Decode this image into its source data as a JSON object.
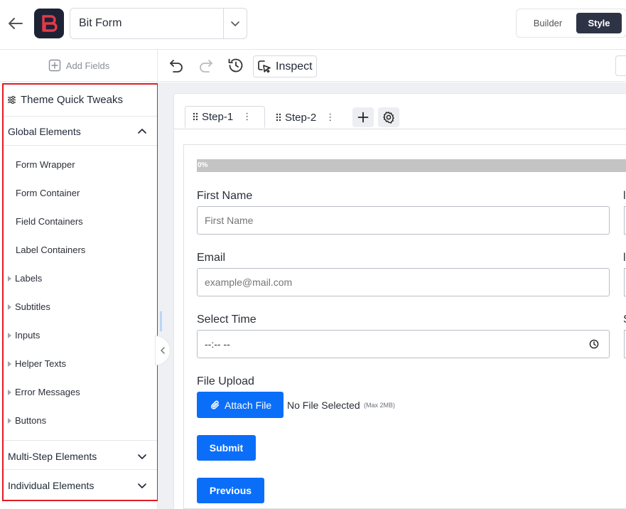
{
  "app": {
    "form_name": "Bit Form"
  },
  "header": {
    "builder_label": "Builder",
    "style_label": "Style"
  },
  "sidebar": {
    "add_fields_label": "Add Fields",
    "theme_title": "Theme Quick Tweaks",
    "global_section": "Global Elements",
    "global_items": [
      "Form Wrapper",
      "Form Container",
      "Field Containers",
      "Label Containers"
    ],
    "expandable_items": [
      "Labels",
      "Subtitles",
      "Inputs",
      "Helper Texts",
      "Error Messages",
      "Buttons"
    ],
    "multistep_section": "Multi-Step Elements",
    "individual_section": "Individual Elements"
  },
  "toolbar": {
    "inspect_label": "Inspect"
  },
  "tabs": {
    "step1": "Step-1",
    "step2": "Step-2"
  },
  "form": {
    "progress": {
      "value": 0,
      "label": "0%"
    },
    "first_name": {
      "label": "First Name",
      "placeholder": "First Name"
    },
    "email": {
      "label": "Email",
      "placeholder": "example@mail.com"
    },
    "select_time": {
      "label": "Select Time",
      "value": "--:-- --"
    },
    "file_upload": {
      "label": "File Upload",
      "button": "Attach File",
      "status": "No File Selected",
      "max_size": "(Max 2MB)"
    },
    "submit_label": "Submit",
    "previous_label": "Previous"
  },
  "colors": {
    "primary_button": "#0a6ef9",
    "highlight_border": "#e01b24",
    "style_tab_bg": "#2e3446",
    "logo_bg": "#1e2235",
    "logo_accent": "#e23a48"
  },
  "icons": [
    "back-arrow-icon",
    "bitform-logo-icon",
    "chevron-down-icon",
    "plus-square-icon",
    "sliders-icon",
    "chevron-up-icon",
    "undo-icon",
    "redo-icon",
    "history-icon",
    "inspect-cursor-icon",
    "drag-handle-icon",
    "kebab-icon",
    "plus-icon",
    "gear-icon",
    "clock-icon",
    "paperclip-icon",
    "chevron-left-icon"
  ]
}
